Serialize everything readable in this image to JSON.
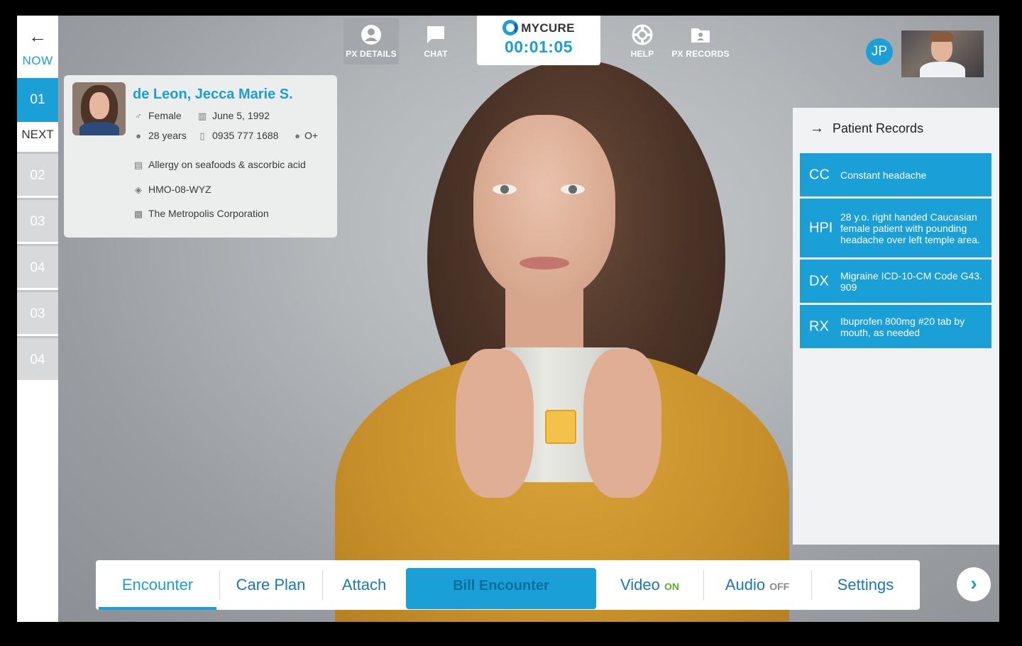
{
  "rail": {
    "back_icon": "arrow-left-icon",
    "now_label": "NOW",
    "current": "01",
    "next_label": "NEXT",
    "queue": [
      "02",
      "03",
      "04",
      "03",
      "04"
    ]
  },
  "toolbar": {
    "px_details": "PX DETAILS",
    "chat": "CHAT",
    "help": "HELP",
    "px_records": "PX RECORDS",
    "active": "PX DETAILS"
  },
  "brand": {
    "name": "MYCURE",
    "timer": "00:01:05"
  },
  "doctor": {
    "initials": "JP"
  },
  "patient": {
    "name": "de Leon, Jecca Marie S.",
    "sex": "Female",
    "birthdate": "June 5, 1992",
    "age": "28 years",
    "phone": "0935 777 1688",
    "blood_type": "O+",
    "allergy": "Allergy on seafoods & ascorbic acid",
    "hmo": "HMO-08-WYZ",
    "company": "The Metropolis Corporation"
  },
  "records": {
    "title": "Patient Records",
    "items": [
      {
        "code": "CC",
        "text": "Constant headache"
      },
      {
        "code": "HPI",
        "text": "28 y.o. right handed Caucasian female patient with pounding headache over left temple area."
      },
      {
        "code": "DX",
        "text": "Migraine ICD-10-CM Code G43. 909"
      },
      {
        "code": "RX",
        "text": "Ibuprofen 800mg #20 tab by mouth, as needed"
      }
    ]
  },
  "tabs": {
    "encounter": "Encounter",
    "care_plan": "Care Plan",
    "attach": "Attach",
    "bill": "Bill Encounter",
    "video": "Video",
    "video_state": "ON",
    "audio": "Audio",
    "audio_state": "OFF",
    "settings": "Settings",
    "active": "Encounter"
  },
  "colors": {
    "accent": "#1a9fd6",
    "on": "#5fae2e",
    "off": "#8a8a8a"
  }
}
